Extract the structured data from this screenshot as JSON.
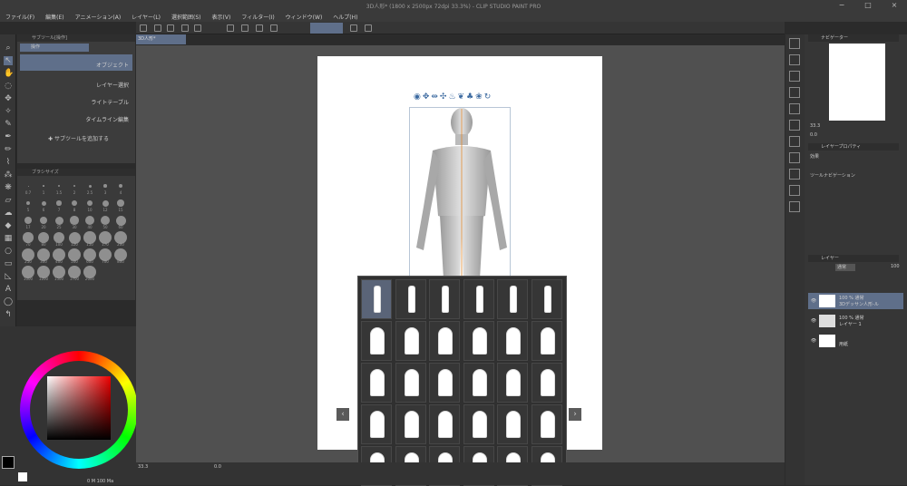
{
  "title": "3D人形* (1800 x 2500px 72dpi 33.3%) - CLIP STUDIO PAINT PRO",
  "menu": [
    "ファイル(F)",
    "編集(E)",
    "アニメーション(A)",
    "レイヤー(L)",
    "選択範囲(S)",
    "表示(V)",
    "フィルター(I)",
    "ウィンドウ(W)",
    "ヘルプ(H)"
  ],
  "doc_tab": "3D人形*",
  "subtool": {
    "header": "サブツール[操作]",
    "tab": "操作",
    "items": [
      "オブジェクト",
      "レイヤー選択",
      "ライトテーブル",
      "タイムライン編集"
    ],
    "add_label": "サブツールを追加する"
  },
  "brush": {
    "header": "ブラシサイズ",
    "sizes": [
      "0.7",
      "1",
      "1.5",
      "2",
      "2.5",
      "3",
      "4",
      "5",
      "6",
      "7",
      "8",
      "10",
      "12",
      "15",
      "17",
      "20",
      "25",
      "30",
      "40",
      "50",
      "60",
      "70",
      "80",
      "100",
      "120",
      "150",
      "170",
      "200",
      "250",
      "300",
      "400",
      "500",
      "600",
      "700",
      "800",
      "1000",
      "1200",
      "1500",
      "1700",
      "2000"
    ]
  },
  "navigator": {
    "header": "ナビゲーター",
    "zoom": "33.3",
    "rotate": "0.0"
  },
  "layer_property": {
    "header": "レイヤープロパティ",
    "effect": "効果",
    "tool_nav": "ツールナビゲーション"
  },
  "layers": {
    "header": "レイヤー",
    "blend": "通常",
    "opacity": "100",
    "items": [
      {
        "line1": "100 % 通常",
        "line2": "3Dデッサン人形-ル"
      },
      {
        "line1": "100 % 通常",
        "line2": "レイヤー 1"
      },
      {
        "line1": "",
        "line2": "用紙"
      }
    ]
  },
  "status": {
    "zoom": "33.3",
    "angle": "0.0",
    "color_info": "0 M 100 Ma"
  }
}
